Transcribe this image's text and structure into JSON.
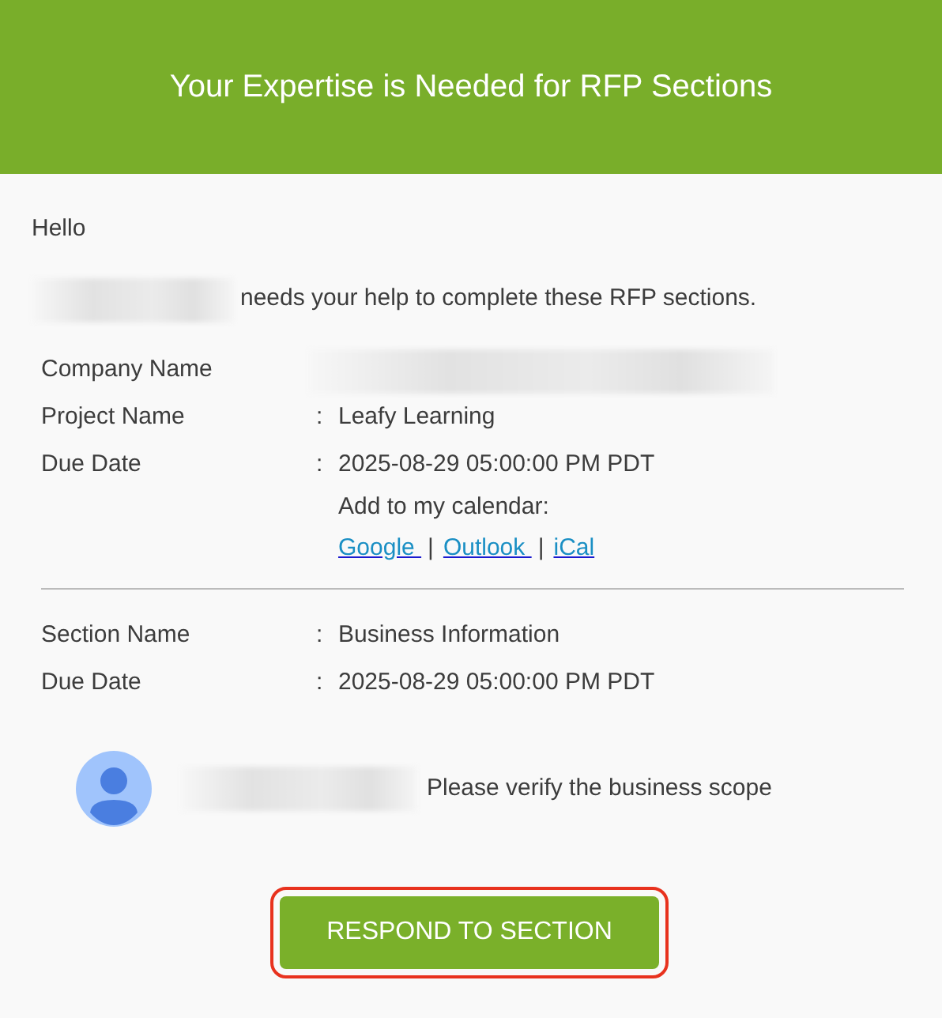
{
  "header": {
    "title": "Your Expertise is Needed for RFP Sections"
  },
  "greeting": "Hello",
  "intro": {
    "sender_redacted": true,
    "text": "needs your help to complete these RFP sections."
  },
  "project_details": [
    {
      "label": "Company Name",
      "value_redacted": true
    },
    {
      "label": "Project Name",
      "separator": ":",
      "value": "Leafy Learning"
    },
    {
      "label": "Due Date",
      "separator": ":",
      "value": "2025-08-29 05:00:00 PM PDT"
    }
  ],
  "calendar": {
    "label": "Add to my calendar:",
    "links": [
      {
        "text": "Google "
      },
      {
        "text": "Outlook "
      },
      {
        "text": "iCal"
      }
    ],
    "divider": "|"
  },
  "section_details": [
    {
      "label": "Section Name",
      "separator": ":",
      "value": "Business Information"
    },
    {
      "label": "Due Date",
      "separator": ":",
      "value": "2025-08-29 05:00:00 PM PDT"
    }
  ],
  "comment": {
    "author_redacted": true,
    "text": "Please verify the business scope"
  },
  "button": {
    "label": "RESPOND TO SECTION",
    "focused": true
  }
}
